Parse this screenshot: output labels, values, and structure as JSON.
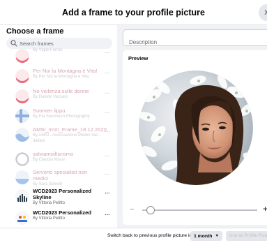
{
  "header": {
    "title": "Add a frame to your profile picture",
    "close_glyph": "✕"
  },
  "left_panel": {
    "heading": "Choose a frame",
    "search_placeholder": "Search frames",
    "more_glyph": "···",
    "frames": [
      {
        "name": "",
        "author": "By Vigile Ferrari",
        "state": "faded",
        "thumb": "arc-red"
      },
      {
        "name": "Per Noi la Montagna è Vita!",
        "author": "By Per Noi la Montagna è Vita",
        "state": "faded",
        "thumb": "arc-red"
      },
      {
        "name": "No violenza sulle donne",
        "author": "By Davide Vaccaro",
        "state": "faded",
        "thumb": "arc-red"
      },
      {
        "name": "Suomen lippu",
        "author": "By Pia Suominen Photography",
        "state": "faded",
        "thumb": "finnish-flag"
      },
      {
        "name": "AMSI_Imm_Frame_18.12.2020",
        "author": "By AMSI - Associazione Medici Sal... Italiani",
        "state": "faded",
        "thumb": "wave-blue"
      },
      {
        "name": "salviamoilturismo",
        "author": "By Claudio Misuri",
        "state": "faded",
        "thumb": "ring-grey"
      },
      {
        "name": "Servono specialisti non medici",
        "author": "By Sara Spinelli",
        "state": "faded",
        "thumb": "blue-bottom"
      },
      {
        "name": "WCD2023 Personalized Skyline",
        "author": "By Vittoria Petitto",
        "state": "active",
        "thumb": "skyline"
      },
      {
        "name": "WCD2023 Personalized",
        "author": "By Vittoria Petitto",
        "state": "active",
        "thumb": "wcd-logo"
      }
    ]
  },
  "right_panel": {
    "description_placeholder": "Description",
    "preview_label": "Preview",
    "zoom_level": 0.04,
    "minus_glyph": "−",
    "plus_glyph": "+"
  },
  "footer": {
    "switch_label": "Switch back to previous profile picture in",
    "duration_value": "1 month",
    "caret_glyph": "▼",
    "use_button_label": "Use as Profile Picture"
  }
}
